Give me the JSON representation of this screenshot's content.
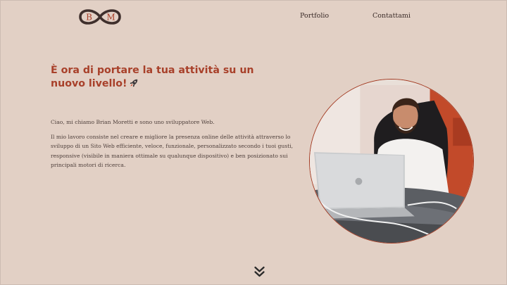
{
  "brand": {
    "logo_letters": [
      "B",
      "M"
    ],
    "colors": {
      "accent": "#a8402a",
      "logo_ring": "#3f2f2c",
      "background": "#e2d0c5"
    }
  },
  "nav": {
    "items": [
      {
        "label": "Portfolio"
      },
      {
        "label": "Contattami"
      }
    ]
  },
  "hero": {
    "headline": "È ora di portare la tua attività su un nuovo livello!",
    "headline_icon": "rocket-icon",
    "intro": "Ciao, mi chiamo Brian Moretti e sono uno sviluppatore Web.",
    "description": "Il mio lavoro consiste nel creare e migliore la presenza online delle attività attraverso lo sviluppo di un Sito Web efficiente, veloce, funzionale, personalizzato secondo i tuoi gusti, responsive (visibile in maniera ottimale su qualunque dispositivo) e ben posizionato sui principali motori di ricerca.",
    "photo_icon": "developer-photo",
    "scroll_icon": "double-chevron-down-icon"
  }
}
